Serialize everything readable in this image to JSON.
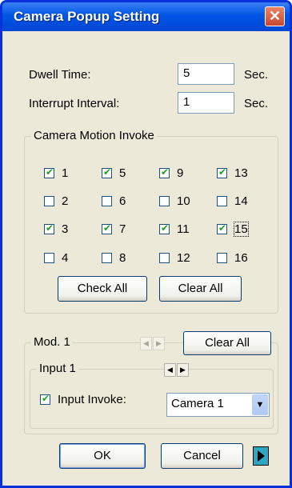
{
  "window": {
    "title": "Camera Popup Setting"
  },
  "timing": {
    "dwell_label": "Dwell Time:",
    "dwell_value": "5",
    "dwell_unit": "Sec.",
    "interrupt_label": "Interrupt Interval:",
    "interrupt_value": "1",
    "interrupt_unit": "Sec."
  },
  "motion": {
    "title": "Camera Motion Invoke",
    "cameras": [
      {
        "label": "1",
        "checked": true
      },
      {
        "label": "2",
        "checked": false
      },
      {
        "label": "3",
        "checked": true
      },
      {
        "label": "4",
        "checked": false
      },
      {
        "label": "5",
        "checked": true
      },
      {
        "label": "6",
        "checked": false
      },
      {
        "label": "7",
        "checked": true
      },
      {
        "label": "8",
        "checked": false
      },
      {
        "label": "9",
        "checked": true
      },
      {
        "label": "10",
        "checked": false
      },
      {
        "label": "11",
        "checked": true
      },
      {
        "label": "12",
        "checked": false
      },
      {
        "label": "13",
        "checked": true
      },
      {
        "label": "14",
        "checked": false
      },
      {
        "label": "15",
        "checked": true
      },
      {
        "label": "16",
        "checked": false
      }
    ],
    "check_all": "Check All",
    "clear_all": "Clear All"
  },
  "module": {
    "title": "Mod. 1",
    "clear_all": "Clear All",
    "input": {
      "title": "Input 1",
      "invoke_label": "Input Invoke:",
      "invoke_checked": true,
      "camera_selected": "Camera 1"
    }
  },
  "footer": {
    "ok": "OK",
    "cancel": "Cancel"
  },
  "icons": {
    "close": "close-icon",
    "spin_left": "arrow-left-icon",
    "spin_right": "arrow-right-icon",
    "dropdown": "dropdown-arrow-icon",
    "more": "play-arrow-icon"
  }
}
